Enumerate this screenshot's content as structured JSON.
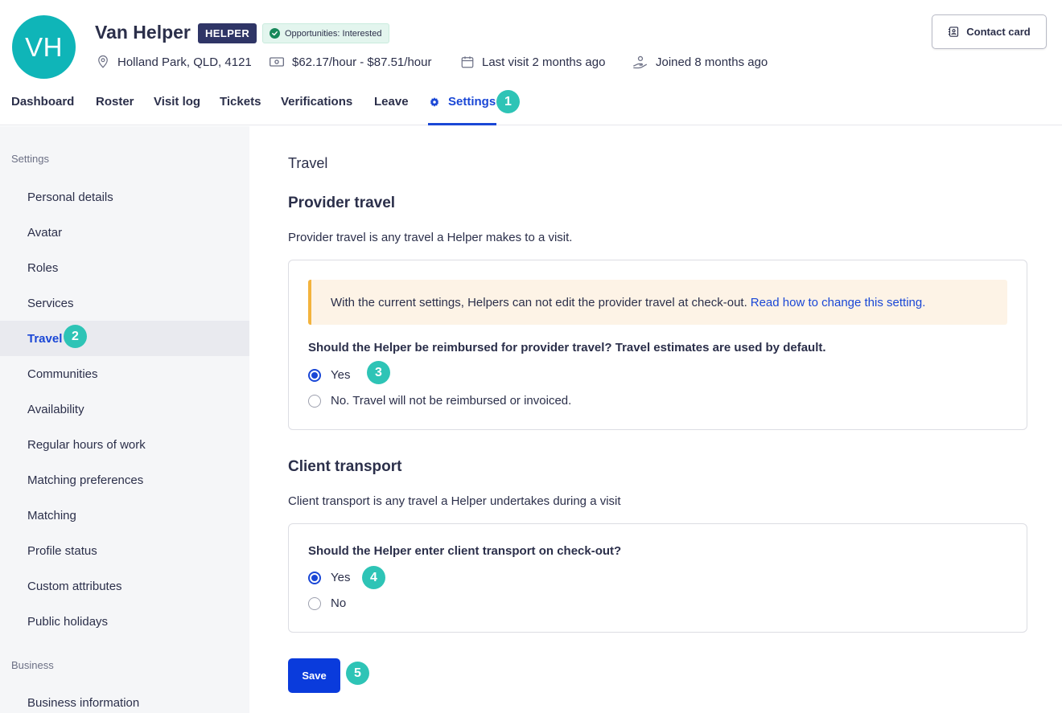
{
  "header": {
    "avatar_initials": "VH",
    "name": "Van Helper",
    "role_badge": "HELPER",
    "opportunity_badge": "Opportunities: Interested",
    "location": "Holland Park, QLD, 4121",
    "rate": "$62.17/hour - $87.51/hour",
    "last_visit": "Last visit 2 months ago",
    "joined": "Joined 8 months ago",
    "contact_card_label": "Contact card"
  },
  "tabs": [
    {
      "label": "Dashboard"
    },
    {
      "label": "Roster"
    },
    {
      "label": "Visit log"
    },
    {
      "label": "Tickets"
    },
    {
      "label": "Verifications"
    },
    {
      "label": "Leave"
    },
    {
      "label": "Settings",
      "active": true
    }
  ],
  "markers": [
    "1",
    "2",
    "3",
    "4",
    "5"
  ],
  "sidebar": {
    "settings_heading": "Settings",
    "items": [
      {
        "label": "Personal details"
      },
      {
        "label": "Avatar"
      },
      {
        "label": "Roles"
      },
      {
        "label": "Services"
      },
      {
        "label": "Travel",
        "active": true
      },
      {
        "label": "Communities"
      },
      {
        "label": "Availability"
      },
      {
        "label": "Regular hours of work"
      },
      {
        "label": "Matching preferences"
      },
      {
        "label": "Matching"
      },
      {
        "label": "Profile status"
      },
      {
        "label": "Custom attributes"
      },
      {
        "label": "Public holidays"
      }
    ],
    "business_heading": "Business",
    "business_items": [
      {
        "label": "Business information"
      }
    ]
  },
  "main": {
    "page_title": "Travel",
    "provider_travel": {
      "heading": "Provider travel",
      "description": "Provider travel is any travel a Helper makes to a visit.",
      "notice_text": "With the current settings, Helpers can not edit the provider travel at check-out.",
      "notice_link": "Read how to change this setting.",
      "question": "Should the Helper be reimbursed for provider travel? Travel estimates are used by default.",
      "options": [
        {
          "label": "Yes",
          "checked": true
        },
        {
          "label": "No. Travel will not be reimbursed or invoiced.",
          "checked": false
        }
      ]
    },
    "client_transport": {
      "heading": "Client transport",
      "description": "Client transport is any travel a Helper undertakes during a visit",
      "question": "Should the Helper enter client transport on check-out?",
      "options": [
        {
          "label": "Yes",
          "checked": true
        },
        {
          "label": "No",
          "checked": false
        }
      ]
    },
    "save_label": "Save"
  },
  "colors": {
    "accent": "#1a47d6",
    "avatar": "#0fb5b8",
    "marker": "#2ec4b6",
    "role_badge": "#2f3566",
    "save_button": "#0a3bdc",
    "notice_bg": "#fdf3e6",
    "notice_border": "#f3b33d"
  }
}
